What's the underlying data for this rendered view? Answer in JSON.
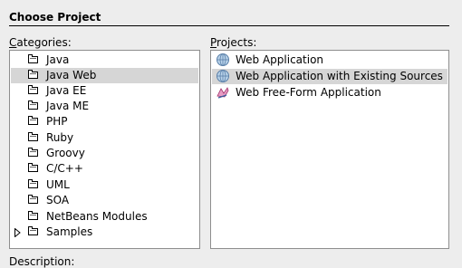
{
  "header": {
    "title": "Choose Project"
  },
  "categories": {
    "label_mnemonic": "C",
    "label_rest": "ategories:",
    "items": [
      {
        "label": "Java",
        "expandable": false
      },
      {
        "label": "Java Web",
        "expandable": false,
        "selected": true
      },
      {
        "label": "Java EE",
        "expandable": false
      },
      {
        "label": "Java ME",
        "expandable": false
      },
      {
        "label": "PHP",
        "expandable": false
      },
      {
        "label": "Ruby",
        "expandable": false
      },
      {
        "label": "Groovy",
        "expandable": false
      },
      {
        "label": "C/C++",
        "expandable": false
      },
      {
        "label": "UML",
        "expandable": false
      },
      {
        "label": "SOA",
        "expandable": false
      },
      {
        "label": "NetBeans Modules",
        "expandable": false
      },
      {
        "label": "Samples",
        "expandable": true
      }
    ]
  },
  "projects": {
    "label_mnemonic": "P",
    "label_rest": "rojects:",
    "items": [
      {
        "label": "Web Application",
        "icon": "globe-icon"
      },
      {
        "label": "Web Application with Existing Sources",
        "icon": "globe-icon",
        "selected": true
      },
      {
        "label": "Web Free-Form Application",
        "icon": "freeform-web-icon"
      }
    ]
  },
  "description": {
    "label": "Description:"
  },
  "colors": {
    "selection": "#d6d6d6",
    "border": "#8e8e8e"
  }
}
